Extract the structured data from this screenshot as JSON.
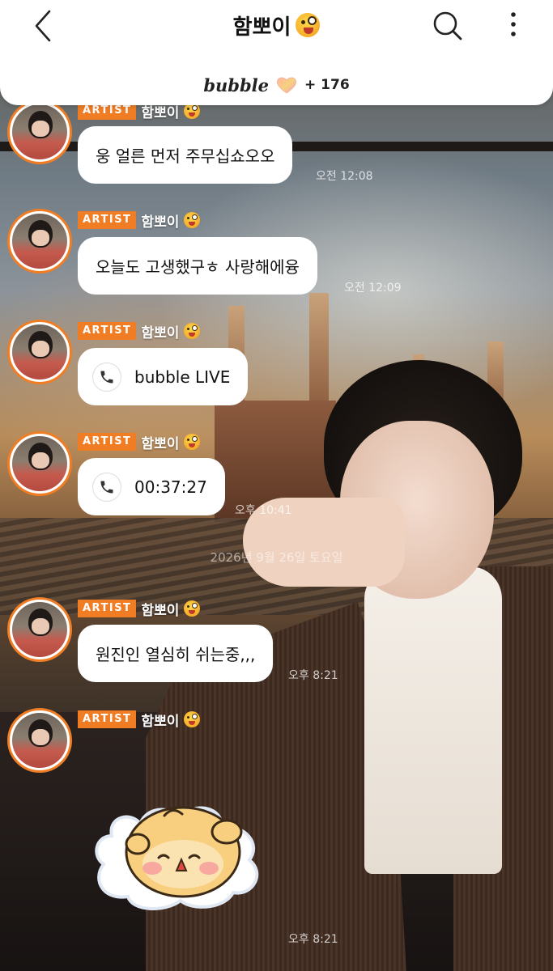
{
  "header": {
    "title": "함뽀이",
    "bubble_logo": "bubble",
    "bubble_count": "+ 176"
  },
  "badge": "ARTIST",
  "sender_name": "함뽀이",
  "messages": [
    {
      "type": "text",
      "text": "웅 얼른 먼저 주무십쇼오오",
      "time": "오전 12:08"
    },
    {
      "type": "text",
      "text": "오늘도 고생했구ㅎ 사랑해에융",
      "time": "오전 12:09"
    },
    {
      "type": "call",
      "text": "bubble LIVE",
      "time": ""
    },
    {
      "type": "call",
      "text": "00:37:27",
      "time": "오후 10:41"
    },
    {
      "type": "text",
      "text": "원진인 열심히 쉬는중,,,",
      "time": "오후 8:21"
    },
    {
      "type": "sticker",
      "text": "",
      "time": "오후 8:21"
    }
  ],
  "date_separator": "2026년 9월 26일 토요일",
  "colors": {
    "accent": "#f07d24",
    "header_bg": "#ffffff",
    "bubble_bg": "#ffffff"
  },
  "icons": {
    "back": "chevron-left-icon",
    "search": "search-icon",
    "more": "more-vertical-icon",
    "heart": "heart-icon",
    "phone": "phone-icon"
  }
}
